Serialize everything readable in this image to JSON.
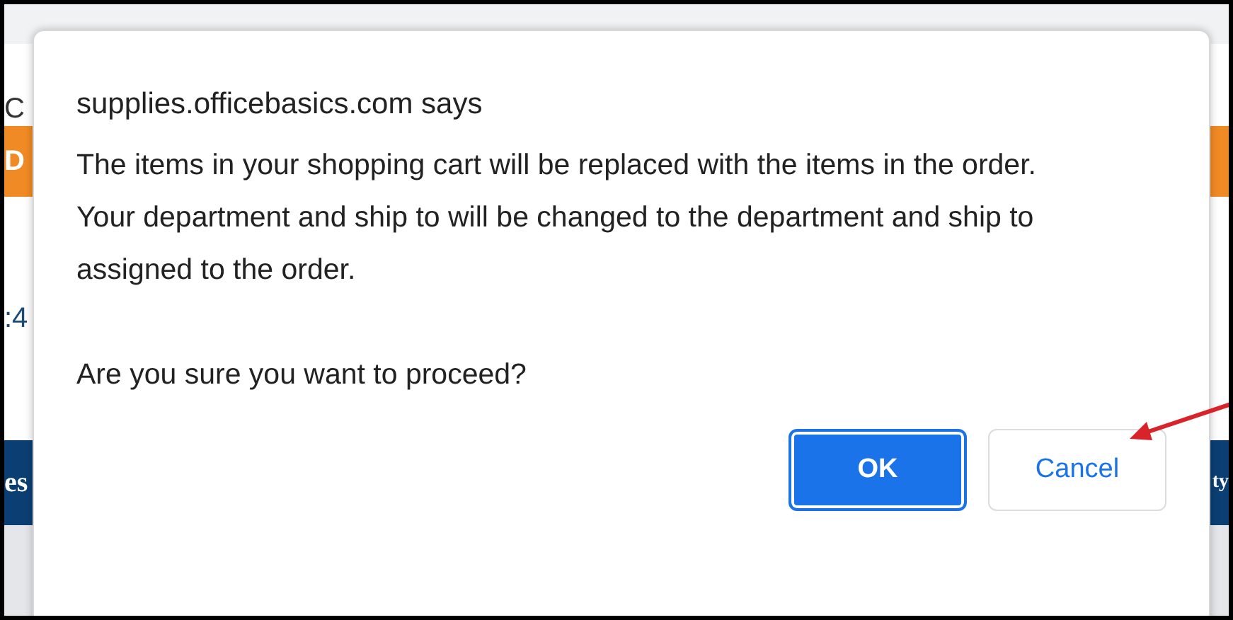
{
  "background": {
    "left_texts": [
      "C",
      "D",
      ":4",
      "es"
    ],
    "right_texts": [
      "ty"
    ]
  },
  "dialog": {
    "title": "supplies.officebasics.com says",
    "paragraphs": [
      "The items in your shopping cart will be replaced with the items in the order.",
      "Your department and ship to will be changed to the department and ship to assigned to the order."
    ],
    "question": "Are you sure you want to proceed?",
    "buttons": [
      {
        "label": "OK",
        "kind": "primary"
      },
      {
        "label": "Cancel",
        "kind": "secondary"
      }
    ]
  }
}
